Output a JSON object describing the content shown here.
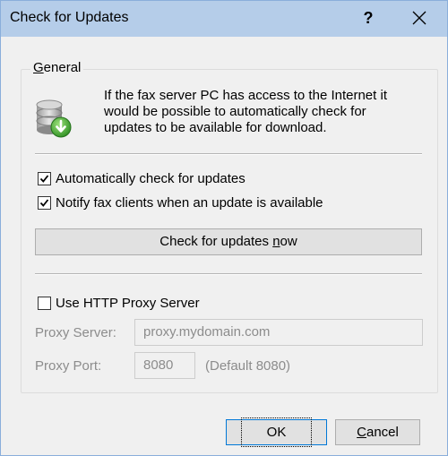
{
  "window": {
    "title": "Check for Updates",
    "help_label": "?",
    "close_icon": "close-icon"
  },
  "general": {
    "group_label_underlined": "G",
    "group_label_rest": "eneral",
    "icon": "database-update-icon",
    "info_text": "If the fax server PC has access to the Internet it would be possible to automatically check for updates to be available for download.",
    "auto_check": {
      "label": "Automatically check for updates",
      "checked": true
    },
    "notify_clients": {
      "label": "Notify fax clients when an update is available",
      "checked": true
    },
    "check_now_button": {
      "label_before": "Check for updates ",
      "label_underlined": "n",
      "label_after": "ow"
    },
    "proxy": {
      "use_proxy": {
        "label": "Use HTTP Proxy Server",
        "checked": false
      },
      "server_label": "Proxy Server:",
      "server_value": "proxy.mydomain.com",
      "port_label": "Proxy Port:",
      "port_value": "8080",
      "port_hint": "(Default 8080)"
    }
  },
  "footer": {
    "ok_label": "OK",
    "cancel_underlined": "C",
    "cancel_rest": "ancel"
  },
  "colors": {
    "titlebar": "#b5cde9",
    "window_bg": "#f0f0f0",
    "disabled_text": "#8c8c8c",
    "check_icon_green": "#3aa82f"
  }
}
